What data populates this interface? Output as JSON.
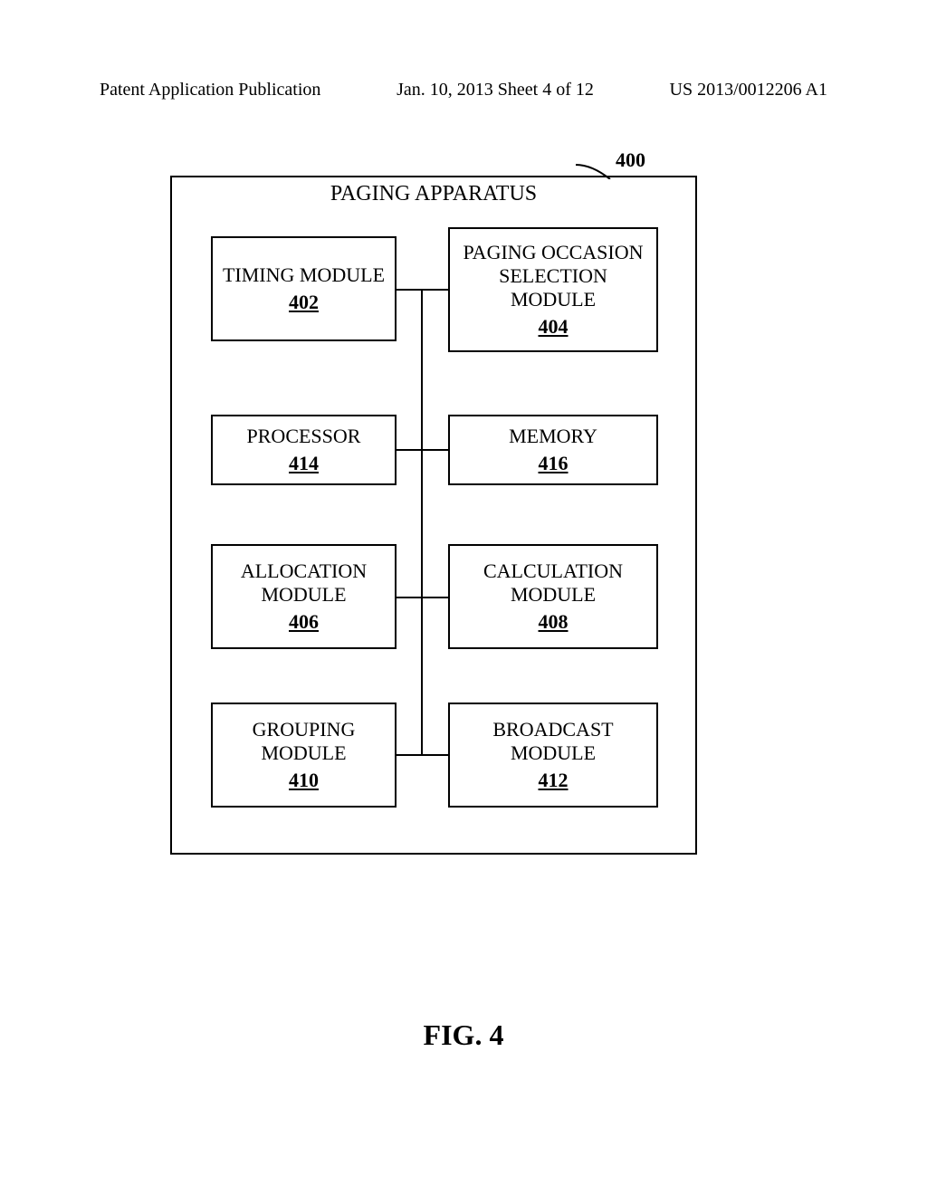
{
  "header": {
    "left": "Patent Application Publication",
    "center": "Jan. 10, 2013  Sheet 4 of 12",
    "right": "US 2013/0012206 A1"
  },
  "apparatus": {
    "title": "PAGING APPARATUS",
    "ref": "400"
  },
  "modules": {
    "timing": {
      "label": "TIMING MODULE",
      "ref": "402"
    },
    "paging": {
      "line1": "PAGING OCCASION",
      "line2": "SELECTION",
      "line3": "MODULE",
      "ref": "404"
    },
    "processor": {
      "label": "PROCESSOR",
      "ref": "414"
    },
    "memory": {
      "label": "MEMORY",
      "ref": "416"
    },
    "allocation": {
      "line1": "ALLOCATION",
      "line2": "MODULE",
      "ref": "406"
    },
    "calculation": {
      "line1": "CALCULATION",
      "line2": "MODULE",
      "ref": "408"
    },
    "grouping": {
      "line1": "GROUPING",
      "line2": "MODULE",
      "ref": "410"
    },
    "broadcast": {
      "line1": "BROADCAST",
      "line2": "MODULE",
      "ref": "412"
    }
  },
  "figure": {
    "caption": "FIG. 4"
  }
}
